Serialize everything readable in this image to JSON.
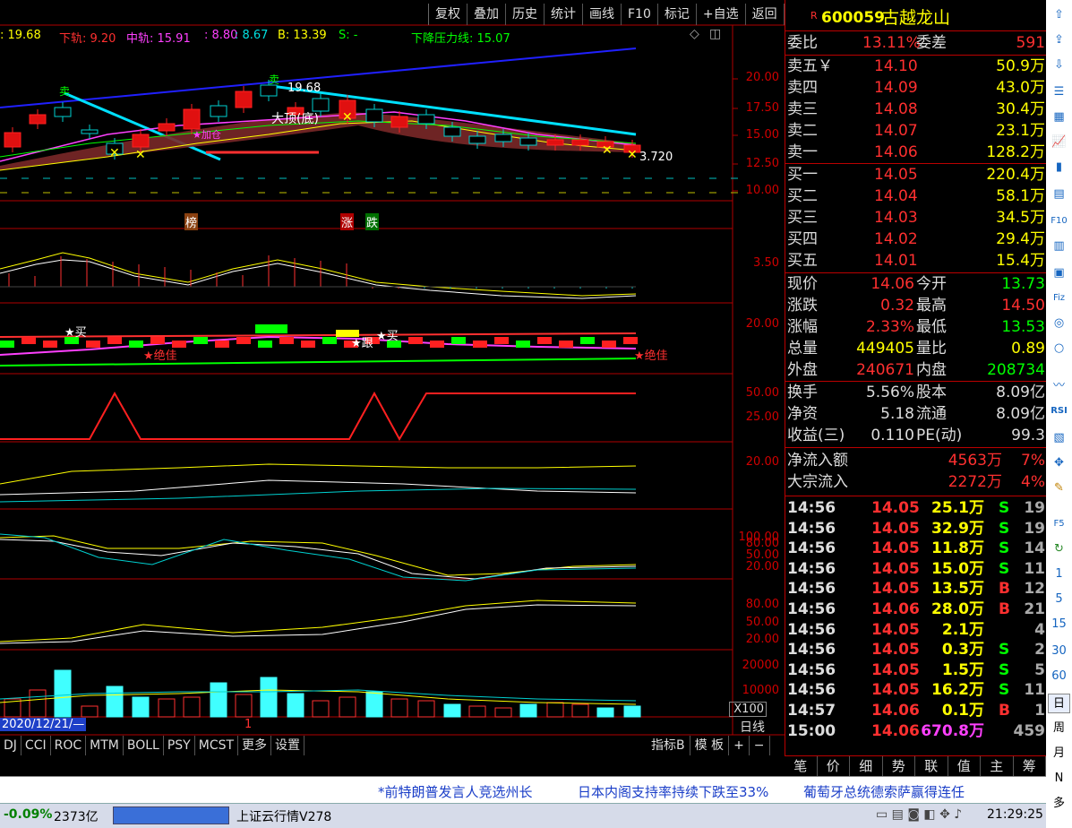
{
  "menu": [
    "复权",
    "叠加",
    "历史",
    "统计",
    "画线",
    "F10",
    "标记",
    "+自选",
    "返回"
  ],
  "indicator_line": {
    "prefix": ": 19.68",
    "lower": "下轨: 9.20",
    "mid": "中轨: 15.91",
    "v1": ": 8.80",
    "v2": ": 8.67",
    "b": "B: 13.39",
    "s": "S: -",
    "pressure": "下降压力线: 15.07"
  },
  "chart_text": {
    "peak_price": "19.68",
    "label_top": "大顶(底)",
    "low_price": "3.720",
    "mark_bang": "榜",
    "mark_zhang": "涨",
    "mark_die": "跌",
    "sig_buy1": "卖",
    "sig_buy2": "卖",
    "sig_sell": "★买",
    "sig_sell2": "★买",
    "sig_jue": "★绝佳",
    "sig_jue2": "★绝佳",
    "sig_gen": "★跟",
    "sig_jia": "★加仓",
    "date_label": "2020/12/21/—",
    "page_num": "1",
    "daily": "日线",
    "x100": "X100"
  },
  "axis_labels": [
    "20.00",
    "17.50",
    "15.00",
    "12.50",
    "10.00",
    "3.50",
    "20.00",
    "50.00",
    "25.00",
    "20.00",
    "100.00",
    "80.00",
    "50.00",
    "20.00",
    "80.00",
    "50.00",
    "20.00",
    "20000",
    "10000"
  ],
  "tabs": [
    "DJ",
    "CCI",
    "ROC",
    "MTM",
    "BOLL",
    "PSY",
    "MCST",
    "更多",
    "设置"
  ],
  "tabs_right": [
    "指标B",
    "模 板",
    "+",
    "−"
  ],
  "stock": {
    "badge": "R",
    "code": "600059",
    "name": "古越龙山"
  },
  "weibi": {
    "l1": "委比",
    "v1": "13.11%",
    "l2": "委差",
    "v2": "591"
  },
  "asks": [
    [
      "卖五￥",
      "14.10",
      "50.9万"
    ],
    [
      "卖四",
      "14.09",
      "43.0万"
    ],
    [
      "卖三",
      "14.08",
      "30.4万"
    ],
    [
      "卖二",
      "14.07",
      "23.1万"
    ],
    [
      "卖一",
      "14.06",
      "128.2万"
    ]
  ],
  "bids": [
    [
      "买一",
      "14.05",
      "220.4万"
    ],
    [
      "买二",
      "14.04",
      "58.1万"
    ],
    [
      "买三",
      "14.03",
      "34.5万"
    ],
    [
      "买四",
      "14.02",
      "29.4万"
    ],
    [
      "买五",
      "14.01",
      "15.4万"
    ]
  ],
  "stats": [
    [
      "现价",
      "14.06",
      "今开",
      "13.73"
    ],
    [
      "涨跌",
      "0.32",
      "最高",
      "14.50"
    ],
    [
      "涨幅",
      "2.33%",
      "最低",
      "13.53"
    ],
    [
      "总量",
      "449405",
      "量比",
      "0.89"
    ],
    [
      "外盘",
      "240671",
      "内盘",
      "208734"
    ]
  ],
  "stats2": [
    [
      "换手",
      "5.56%",
      "股本",
      "8.09亿"
    ],
    [
      "净资",
      "5.18",
      "流通",
      "8.09亿"
    ],
    [
      "收益(三)",
      "0.110",
      "PE(动)",
      "99.3"
    ]
  ],
  "flow": [
    [
      "净流入额",
      "4563万",
      "7%"
    ],
    [
      "大宗流入",
      "2272万",
      "4%"
    ]
  ],
  "trades": [
    [
      "14:56",
      "14.05",
      "25.1万",
      "S",
      "19"
    ],
    [
      "14:56",
      "14.05",
      "32.9万",
      "S",
      "19"
    ],
    [
      "14:56",
      "14.05",
      "11.8万",
      "S",
      "14"
    ],
    [
      "14:56",
      "14.05",
      "15.0万",
      "S",
      "11"
    ],
    [
      "14:56",
      "14.05",
      "13.5万",
      "B",
      "12"
    ],
    [
      "14:56",
      "14.06",
      "28.0万",
      "B",
      "21"
    ],
    [
      "14:56",
      "14.05",
      "2.1万",
      "",
      "4"
    ],
    [
      "14:56",
      "14.05",
      "0.3万",
      "S",
      "2"
    ],
    [
      "14:56",
      "14.05",
      "1.5万",
      "S",
      "5"
    ],
    [
      "14:56",
      "14.05",
      "16.2万",
      "S",
      "11"
    ],
    [
      "14:57",
      "14.06",
      "0.1万",
      "B",
      "1"
    ],
    [
      "15:00",
      "14.06",
      "670.8万",
      "",
      "459"
    ]
  ],
  "bottom_tabs": [
    "笔",
    "价",
    "细",
    "势",
    "联",
    "值",
    "主",
    "筹"
  ],
  "ticker": [
    "*前特朗普发言人竞选州长",
    "日本内阁支持率持续下跌至33%",
    "葡萄牙总统德索萨赢得连任"
  ],
  "status": {
    "pct": "-0.09%",
    "amt": "2373亿",
    "cloud": "上证云行情V278",
    "time": "21:29:25"
  },
  "rtool": [
    "1",
    "5",
    "15",
    "30",
    "60",
    "日",
    "周",
    "月",
    "N",
    "多",
    "RSI"
  ],
  "colors": {
    "up": "#ff3030",
    "down": "#00e0e0",
    "yellow": "#ffff00",
    "green": "#00ff00",
    "magenta": "#ff00ff"
  }
}
